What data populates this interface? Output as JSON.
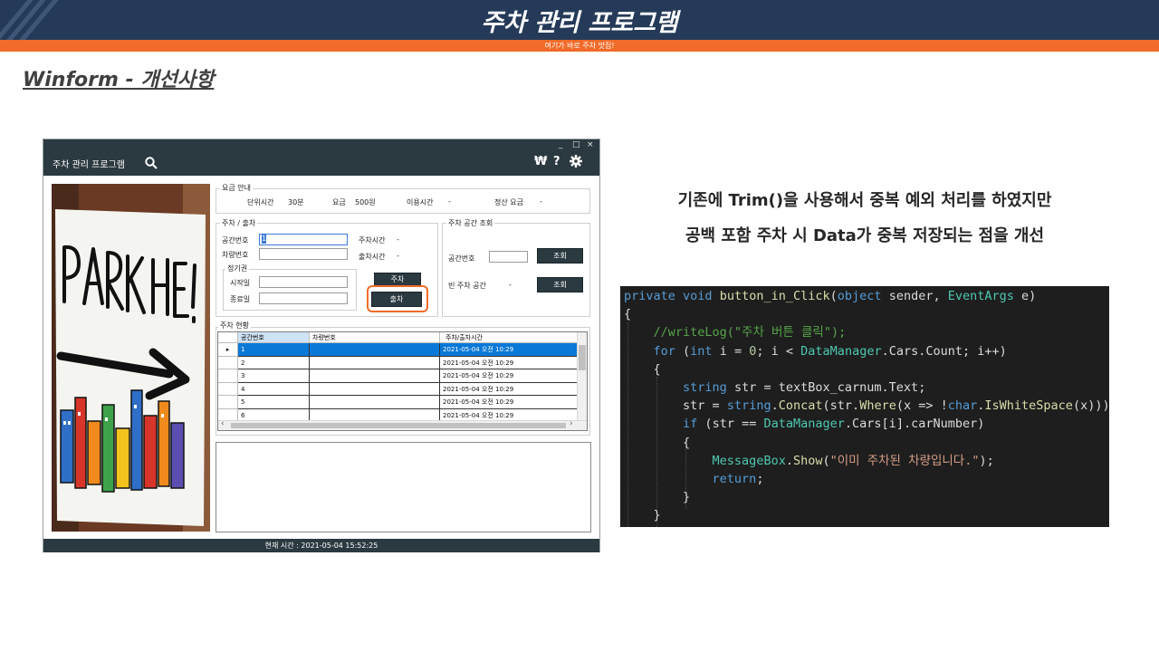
{
  "slide": {
    "title": "주차 관리 프로그램",
    "subtitle": "여기가 바로 주차 맛집!",
    "section_title": "Winform - 개선사항"
  },
  "colors": {
    "header_navy": "#253a59",
    "accent_orange": "#f26b2a",
    "form_dark": "#2b3940",
    "grid_selected": "#0a78d7",
    "code_background": "#1e1e1e"
  },
  "winform": {
    "title": "주차 관리 프로그램",
    "window_controls": [
      "_",
      "□",
      "×"
    ],
    "toolbar_icons": [
      "search-icon",
      "won-icon",
      "help-icon",
      "settings-icon"
    ],
    "photo_alt": "PARK HERE! sign",
    "fee_group": {
      "label": "요금 안내",
      "unit_time_label": "단위시간",
      "unit_time_value": "30분",
      "fee_label": "요금",
      "fee_value": "500원",
      "usage_time_label": "이용시간",
      "usage_time_value": "-",
      "settle_fee_label": "정산 요금",
      "settle_fee_value": "-"
    },
    "parking_group": {
      "label": "주차 / 출차",
      "space_no_label": "공간번호",
      "space_no_value": "1",
      "car_no_label": "차량번호",
      "park_time_label": "주차시간",
      "park_time_value": "-",
      "exit_time_label": "출차시간",
      "exit_time_value": "-",
      "season_pass_label": "정기권",
      "start_date_label": "시작일",
      "end_date_label": "종료일",
      "park_button": "주차",
      "exit_button": "출차"
    },
    "lookup_group": {
      "label": "주차 공간 조회",
      "space_no_label": "공간번호",
      "lookup_button": "조회",
      "empty_space_label": "빈 주차 공간",
      "empty_space_value": "-",
      "lookup_button_2": "조회"
    },
    "status_group": {
      "label": "주차 현황",
      "columns": [
        "공간번호",
        "차량번호",
        "주차/출차시간"
      ],
      "rows": [
        {
          "space": "1",
          "car": "",
          "time": "2021-05-04 오전 10:29",
          "selected": true
        },
        {
          "space": "2",
          "car": "",
          "time": "2021-05-04 오전 10:29",
          "selected": false
        },
        {
          "space": "3",
          "car": "",
          "time": "2021-05-04 오전 10:29",
          "selected": false
        },
        {
          "space": "4",
          "car": "",
          "time": "2021-05-04 오전 10:29",
          "selected": false
        },
        {
          "space": "5",
          "car": "",
          "time": "2021-05-04 오전 10:29",
          "selected": false
        },
        {
          "space": "6",
          "car": "",
          "time": "2021-05-04 오전 10:29",
          "selected": false
        }
      ]
    },
    "status_bar": "현재 시간 : 2021-05-04 15:52:25"
  },
  "description": {
    "line1": "기존에 Trim()을 사용해서 중복 예외 처리를 하였지만",
    "line2": "공백 포함 주차 시 Data가 중복 저장되는 점을 개선"
  },
  "code": {
    "lines": [
      "private void button_in_Click(object sender, EventArgs e)",
      "{",
      "    //writeLog(\"주차 버튼 클릭\");",
      "    for (int i = 0; i < DataManager.Cars.Count; i++)",
      "    {",
      "        string str = textBox_carnum.Text;",
      "        str = string.Concat(str.Where(x => !char.IsWhiteSpace(x)));",
      "        if (str == DataManager.Cars[i].carNumber)",
      "        {",
      "            MessageBox.Show(\"이미 주차된 차량입니다.\");",
      "            return;",
      "        }",
      "    }"
    ]
  }
}
